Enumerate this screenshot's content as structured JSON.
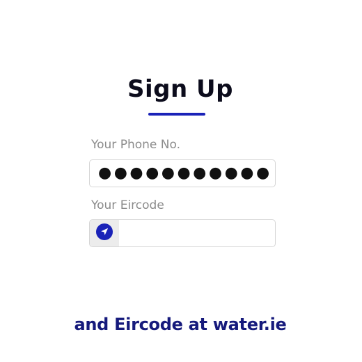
{
  "title": "Sign Up",
  "colors": {
    "accent": "#1a22b8",
    "footer_text": "#161a7c"
  },
  "phone": {
    "label": "Your Phone No.",
    "value_masked": "●●●●●●●●●●●"
  },
  "eircode": {
    "label": "Your Eircode",
    "value": "",
    "icon": "location-arrow-icon"
  },
  "footer": {
    "text": "and Eircode at water.ie"
  }
}
